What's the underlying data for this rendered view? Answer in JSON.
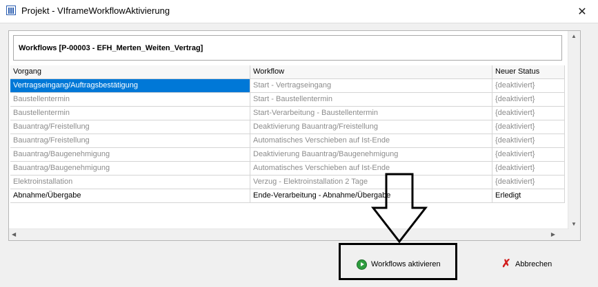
{
  "window": {
    "title": "Projekt - VIframeWorkflowAktivierung",
    "app_icon": "columns-icon",
    "close_glyph": "✕"
  },
  "header": {
    "caption": "Workflows [P-00003 - EFH_Merten_Weiten_Vertrag]"
  },
  "grid": {
    "columns": [
      "Vorgang",
      "Workflow",
      "Neuer Status"
    ],
    "rows": [
      {
        "vorgang": "Vertragseingang/Auftragsbestätigung",
        "workflow": "Start - Vertragseingang",
        "status": "{deaktiviert}",
        "active": false,
        "selected": true
      },
      {
        "vorgang": "Baustellentermin",
        "workflow": "Start - Baustellentermin",
        "status": "{deaktiviert}",
        "active": false,
        "selected": false
      },
      {
        "vorgang": "Baustellentermin",
        "workflow": "Start-Verarbeitung - Baustellentermin",
        "status": "{deaktiviert}",
        "active": false,
        "selected": false
      },
      {
        "vorgang": "Bauantrag/Freistellung",
        "workflow": "Deaktivierung Bauantrag/Freistellung",
        "status": "{deaktiviert}",
        "active": false,
        "selected": false
      },
      {
        "vorgang": "Bauantrag/Freistellung",
        "workflow": "Automatisches Verschieben auf Ist-Ende",
        "status": "{deaktiviert}",
        "active": false,
        "selected": false
      },
      {
        "vorgang": "Bauantrag/Baugenehmigung",
        "workflow": "Deaktivierung Bauantrag/Baugenehmigung",
        "status": "{deaktiviert}",
        "active": false,
        "selected": false
      },
      {
        "vorgang": "Bauantrag/Baugenehmigung",
        "workflow": "Automatisches Verschieben auf Ist-Ende",
        "status": "{deaktiviert}",
        "active": false,
        "selected": false
      },
      {
        "vorgang": "Elektroinstallation",
        "workflow": "Verzug - Elektroinstallation 2 Tage",
        "status": "{deaktiviert}",
        "active": false,
        "selected": false
      },
      {
        "vorgang": "Abnahme/Übergabe",
        "workflow": "Ende-Verarbeitung - Abnahme/Übergabe",
        "status": "Erledigt",
        "active": true,
        "selected": false
      }
    ]
  },
  "buttons": {
    "activate_label": "Workflows aktivieren",
    "activate_icon": "play-icon",
    "cancel_label": "Abbrechen",
    "cancel_icon": "red-x-icon"
  },
  "colors": {
    "selection": "#0078d7",
    "inactive_text": "#8c8c8c",
    "activate_icon": "#2e9d3f",
    "cancel_icon": "#d21f1f"
  }
}
